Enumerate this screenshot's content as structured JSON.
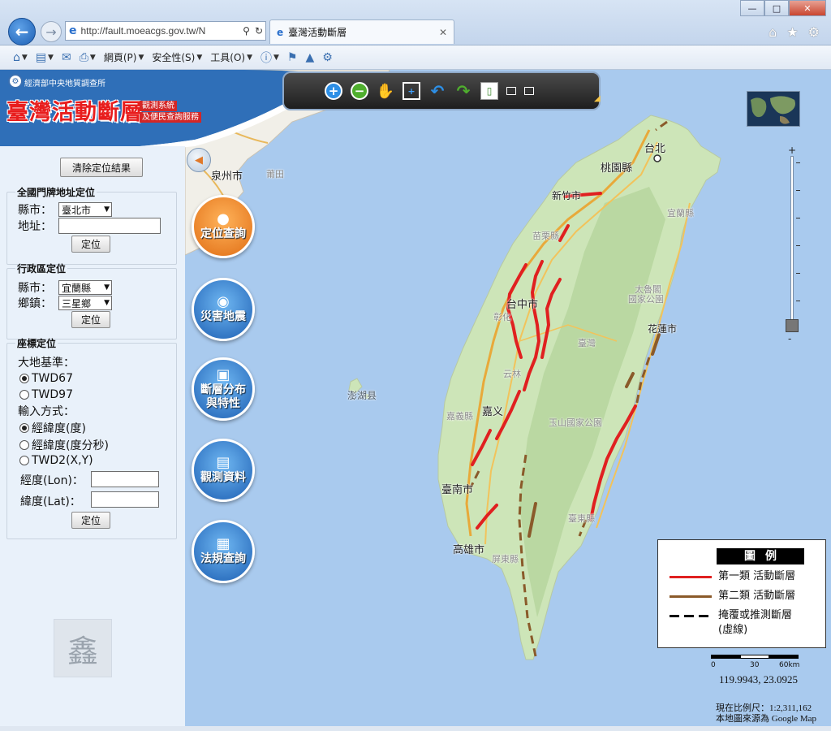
{
  "browser": {
    "url": "http://fault.moeacgs.gov.tw/N",
    "tab_title": "臺灣活動斷層",
    "menu": {
      "page": "網頁(P)",
      "safety": "安全性(S)",
      "tools": "工具(O)"
    }
  },
  "header": {
    "org": "經濟部中央地質調查所",
    "title": "臺灣活動斷層",
    "sub1": "觀測系統",
    "sub2": "及便民查詢服務"
  },
  "left_panel": {
    "clear_button": "清除定位結果",
    "address_group": {
      "title": "全國門牌地址定位",
      "county_label": "縣市：",
      "county_value": "臺北市",
      "address_label": "地址：",
      "address_value": "",
      "locate_button": "定位"
    },
    "district_group": {
      "title": "行政區定位",
      "county_label": "縣市：",
      "county_value": "宜蘭縣",
      "town_label": "鄉鎮：",
      "town_value": "三星鄉",
      "locate_button": "定位"
    },
    "coord_group": {
      "title": "座標定位",
      "datum_label": "大地基準：",
      "datum_options": [
        "TWD67",
        "TWD97"
      ],
      "datum_selected": "TWD67",
      "input_label": "輸入方式：",
      "input_options": [
        "經緯度(度)",
        "經緯度(度分秒)",
        "TWD2(X,Y)"
      ],
      "input_selected": "經緯度(度)",
      "lon_label": "經度(Lon)：",
      "lon_value": "",
      "lat_label": "緯度(Lat)：",
      "lat_value": "",
      "locate_button": "定位"
    }
  },
  "side_buttons": [
    {
      "label1": "定位查詢",
      "label2": ""
    },
    {
      "label1": "災害地震",
      "label2": ""
    },
    {
      "label1": "斷層分布",
      "label2": "與特性"
    },
    {
      "label1": "觀測資料",
      "label2": ""
    },
    {
      "label1": "法規查詢",
      "label2": ""
    }
  ],
  "map": {
    "labels": {
      "taipei": "台北",
      "taoyuan": "桃園縣",
      "hsinchu": "新竹市",
      "yilan": "宜蘭縣",
      "miaoli": "苗栗縣",
      "taichung": "台中市",
      "taroko": "太魯閣",
      "taroko_park": "國家公園",
      "taiwan": "臺灣",
      "hualien": "花蓮市",
      "yunlin": "云林",
      "chiayi": "嘉义",
      "chiayi_county": "嘉義縣",
      "yushan": "玉山國家公園",
      "tainan": "臺南市",
      "kaohsiung": "高雄市",
      "pingtung": "屏東縣",
      "taitung": "臺東縣",
      "penghu": "澎湖县",
      "quanzhou": "泉州市",
      "putian": "莆田",
      "changhua": "彰化"
    },
    "legend": {
      "title": "圖例",
      "class1": "第一類 活動斷層",
      "class2": "第二類 活動斷層",
      "inferred": "掩覆或推測斷層",
      "inferred2": "(虛線)",
      "class1_color": "#e02020",
      "class2_color": "#8a5a2a"
    },
    "scale": {
      "zero": "0",
      "mid": "30",
      "max": "60km"
    },
    "coordinates": "119.9943, 23.0925",
    "scale_text": "現在比例尺：1:2,311,162",
    "source_text": "本地圖來源為 Google Map"
  },
  "watermark": "鑫"
}
